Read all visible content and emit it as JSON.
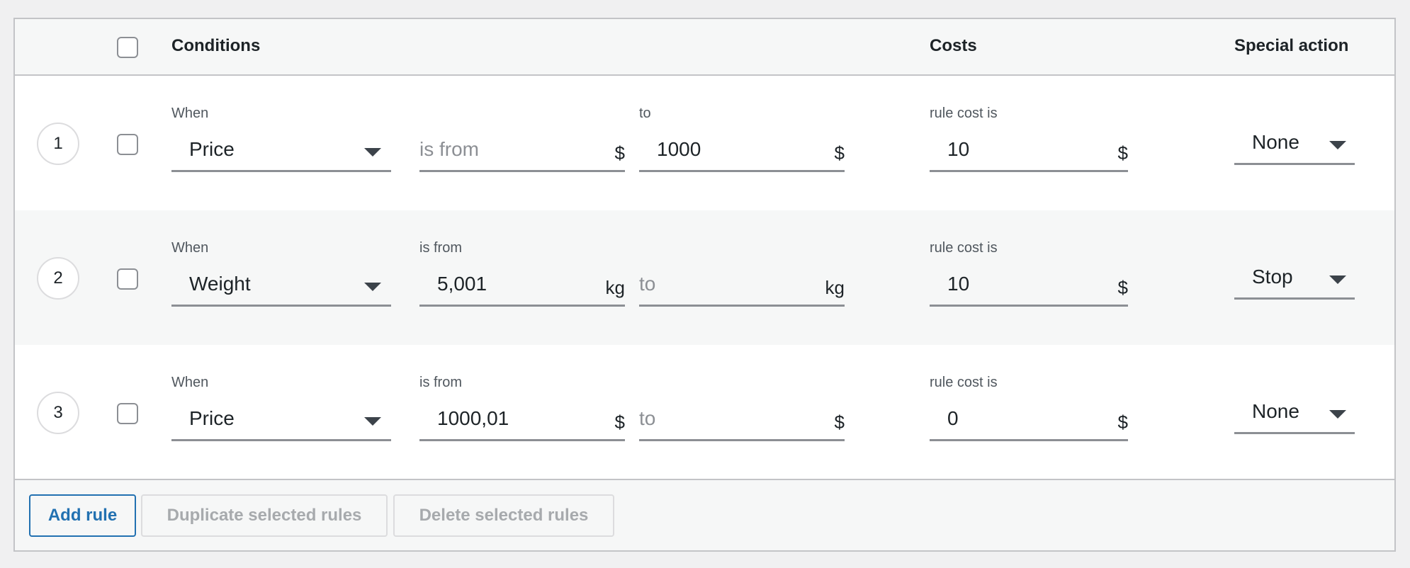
{
  "header": {
    "conditions": "Conditions",
    "costs": "Costs",
    "special_action": "Special action"
  },
  "rules": [
    {
      "number": "1",
      "when_label": "When",
      "when": "Price",
      "from_label": "",
      "from_value": "",
      "from_placeholder": "is from",
      "from_unit": "$",
      "to_label": "to",
      "to_value": "1000",
      "to_placeholder": "",
      "to_unit": "$",
      "cost_label": "rule cost is",
      "cost": "10",
      "cost_unit": "$",
      "action": "None"
    },
    {
      "number": "2",
      "when_label": "When",
      "when": "Weight",
      "from_label": "is from",
      "from_value": "5,001",
      "from_placeholder": "",
      "from_unit": "kg",
      "to_label": "",
      "to_value": "",
      "to_placeholder": "to",
      "to_unit": "kg",
      "cost_label": "rule cost is",
      "cost": "10",
      "cost_unit": "$",
      "action": "Stop"
    },
    {
      "number": "3",
      "when_label": "When",
      "when": "Price",
      "from_label": "is from",
      "from_value": "1000,01",
      "from_placeholder": "",
      "from_unit": "$",
      "to_label": "",
      "to_value": "",
      "to_placeholder": "to",
      "to_unit": "$",
      "cost_label": "rule cost is",
      "cost": "0",
      "cost_unit": "$",
      "action": "None"
    }
  ],
  "footer": {
    "add": "Add rule",
    "duplicate": "Duplicate selected rules",
    "delete": "Delete selected rules"
  },
  "colors": {
    "primary": "#2271b1",
    "border": "#c3c4c7"
  }
}
